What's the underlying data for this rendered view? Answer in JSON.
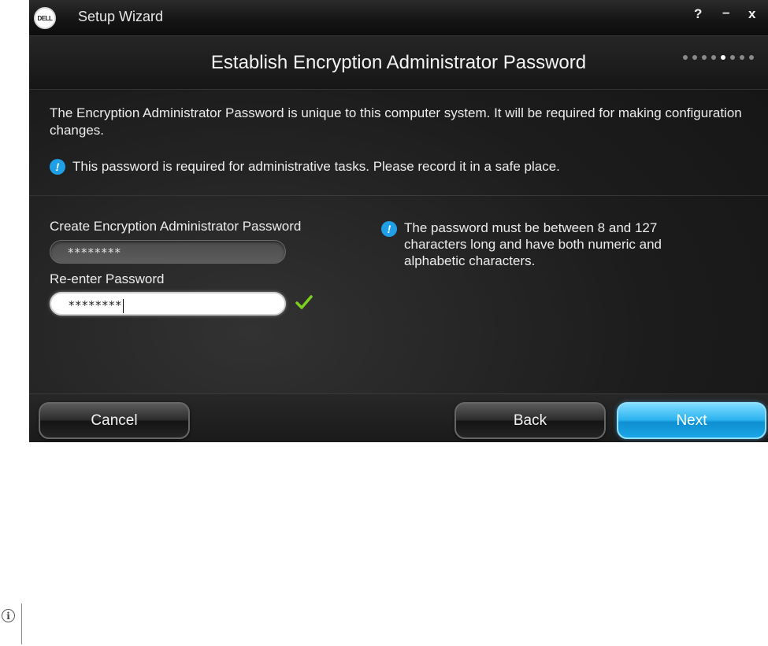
{
  "window": {
    "logo_text": "DELL",
    "title": "Setup Wizard",
    "help_label": "?",
    "minimize_label": "–",
    "close_label": "x"
  },
  "page": {
    "title": "Establish Encryption Administrator Password",
    "progress": {
      "total_steps": 8,
      "current_step": 5
    }
  },
  "description": "The Encryption Administrator Password is unique to this computer system. It will be required for making configuration changes.",
  "note_primary": "This password is required for administrative tasks.  Please record it in a safe place.",
  "form": {
    "create_label": "Create Encryption Administrator Password",
    "create_value": "********",
    "reenter_label": "Re-enter Password",
    "reenter_value": "********",
    "match_status": "check-mark-icon"
  },
  "note_requirements": "The password must be between 8 and 127 characters long and have both numeric and alphabetic characters.",
  "buttons": {
    "cancel": "Cancel",
    "back": "Back",
    "next": "Next"
  },
  "colors": {
    "accent": "#1fa0e6",
    "next_button": "#2bb3ef",
    "success": "#7ccf1e"
  },
  "icons": {
    "info": "info-icon",
    "check": "check-mark-icon",
    "note": "info-circle-icon"
  }
}
